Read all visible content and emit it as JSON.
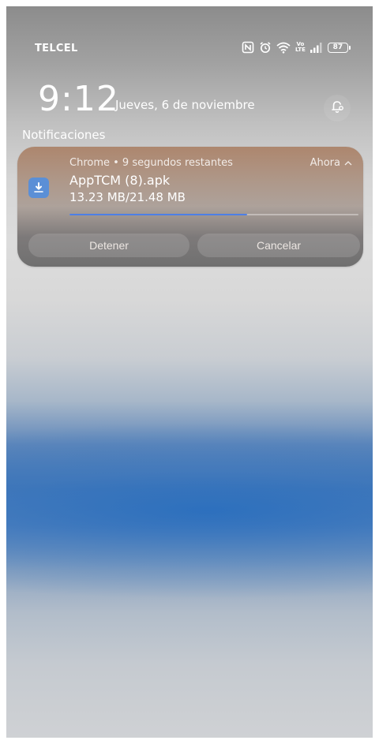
{
  "status_bar": {
    "carrier": "TELCEL",
    "volte_top": "Vo",
    "volte_bottom": "LTE",
    "battery_percent": "87",
    "icons": [
      "nfc-icon",
      "alarm-icon",
      "wifi-icon",
      "volte-icon",
      "signal-icon",
      "battery-icon"
    ]
  },
  "lock_header": {
    "time": "9:12",
    "date": "Jueves, 6 de noviembre"
  },
  "notifications": {
    "section_title": "Notificaciones",
    "items": [
      {
        "app_icon": "download-icon",
        "meta": "Chrome • 9 segundos restantes",
        "time": "Ahora",
        "title": "AppTCM (8).apk",
        "subtitle": "13.23 MB/21.48 MB",
        "progress": 0.616,
        "actions": [
          {
            "label": "Detener"
          },
          {
            "label": "Cancelar"
          }
        ]
      }
    ]
  },
  "colors": {
    "progress": "#4d7fe6",
    "app_icon_bg": "#5b8fd6"
  }
}
